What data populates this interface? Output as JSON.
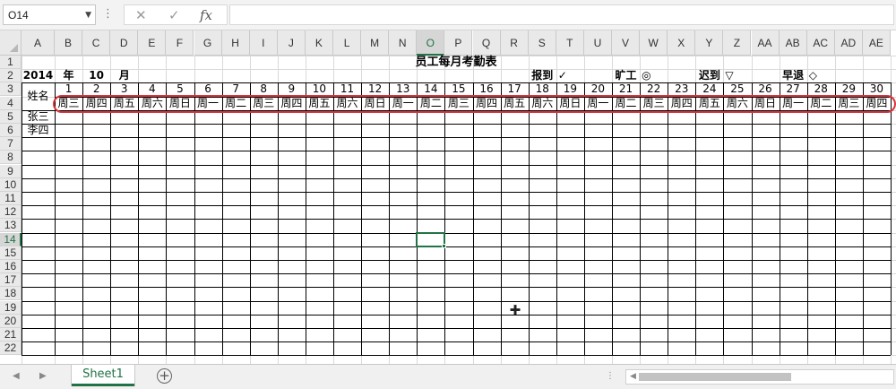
{
  "formula_bar": {
    "name_box": "O14",
    "formula": "",
    "cancel_glyph": "✕",
    "enter_glyph": "✓",
    "fx_label": "fx"
  },
  "columns": [
    "A",
    "B",
    "C",
    "D",
    "E",
    "F",
    "G",
    "H",
    "I",
    "J",
    "K",
    "L",
    "M",
    "N",
    "O",
    "P",
    "Q",
    "R",
    "S",
    "T",
    "U",
    "V",
    "W",
    "X",
    "Y",
    "Z",
    "AA",
    "AB",
    "AC",
    "AD",
    "AE"
  ],
  "rows": [
    "1",
    "2",
    "3",
    "4",
    "5",
    "6",
    "7",
    "8",
    "9",
    "10",
    "11",
    "12",
    "13",
    "14",
    "15",
    "16",
    "17",
    "18",
    "19",
    "20",
    "21",
    "22"
  ],
  "active_cell": {
    "column": "O",
    "row": "14"
  },
  "sheet": {
    "title": "员工每月考勤表",
    "year": "2014",
    "year_unit": "年",
    "month": "10",
    "month_unit": "月",
    "legend": [
      {
        "label": "报到",
        "symbol": "✓"
      },
      {
        "label": "旷工",
        "symbol": "◎"
      },
      {
        "label": "迟到",
        "symbol": "▽"
      },
      {
        "label": "早退",
        "symbol": "◇"
      }
    ],
    "name_header": "姓名",
    "days": [
      "1",
      "2",
      "3",
      "4",
      "5",
      "6",
      "7",
      "8",
      "9",
      "10",
      "11",
      "12",
      "13",
      "14",
      "15",
      "16",
      "17",
      "18",
      "19",
      "20",
      "21",
      "22",
      "23",
      "24",
      "25",
      "26",
      "27",
      "28",
      "29",
      "30"
    ],
    "weekdays": [
      "周三",
      "周四",
      "周五",
      "周六",
      "周日",
      "周一",
      "周二",
      "周三",
      "周四",
      "周五",
      "周六",
      "周日",
      "周一",
      "周二",
      "周三",
      "周四",
      "周五",
      "周六",
      "周日",
      "周一",
      "周二",
      "周三",
      "周四",
      "周五",
      "周六",
      "周日",
      "周一",
      "周二",
      "周三",
      "周四"
    ],
    "employees": [
      "张三",
      "李四"
    ]
  },
  "sheet_tabs": [
    {
      "label": "Sheet1",
      "active": true
    }
  ],
  "add_sheet_glyph": "+",
  "accent_color": "#217346",
  "highlight_color": "#d9343e"
}
